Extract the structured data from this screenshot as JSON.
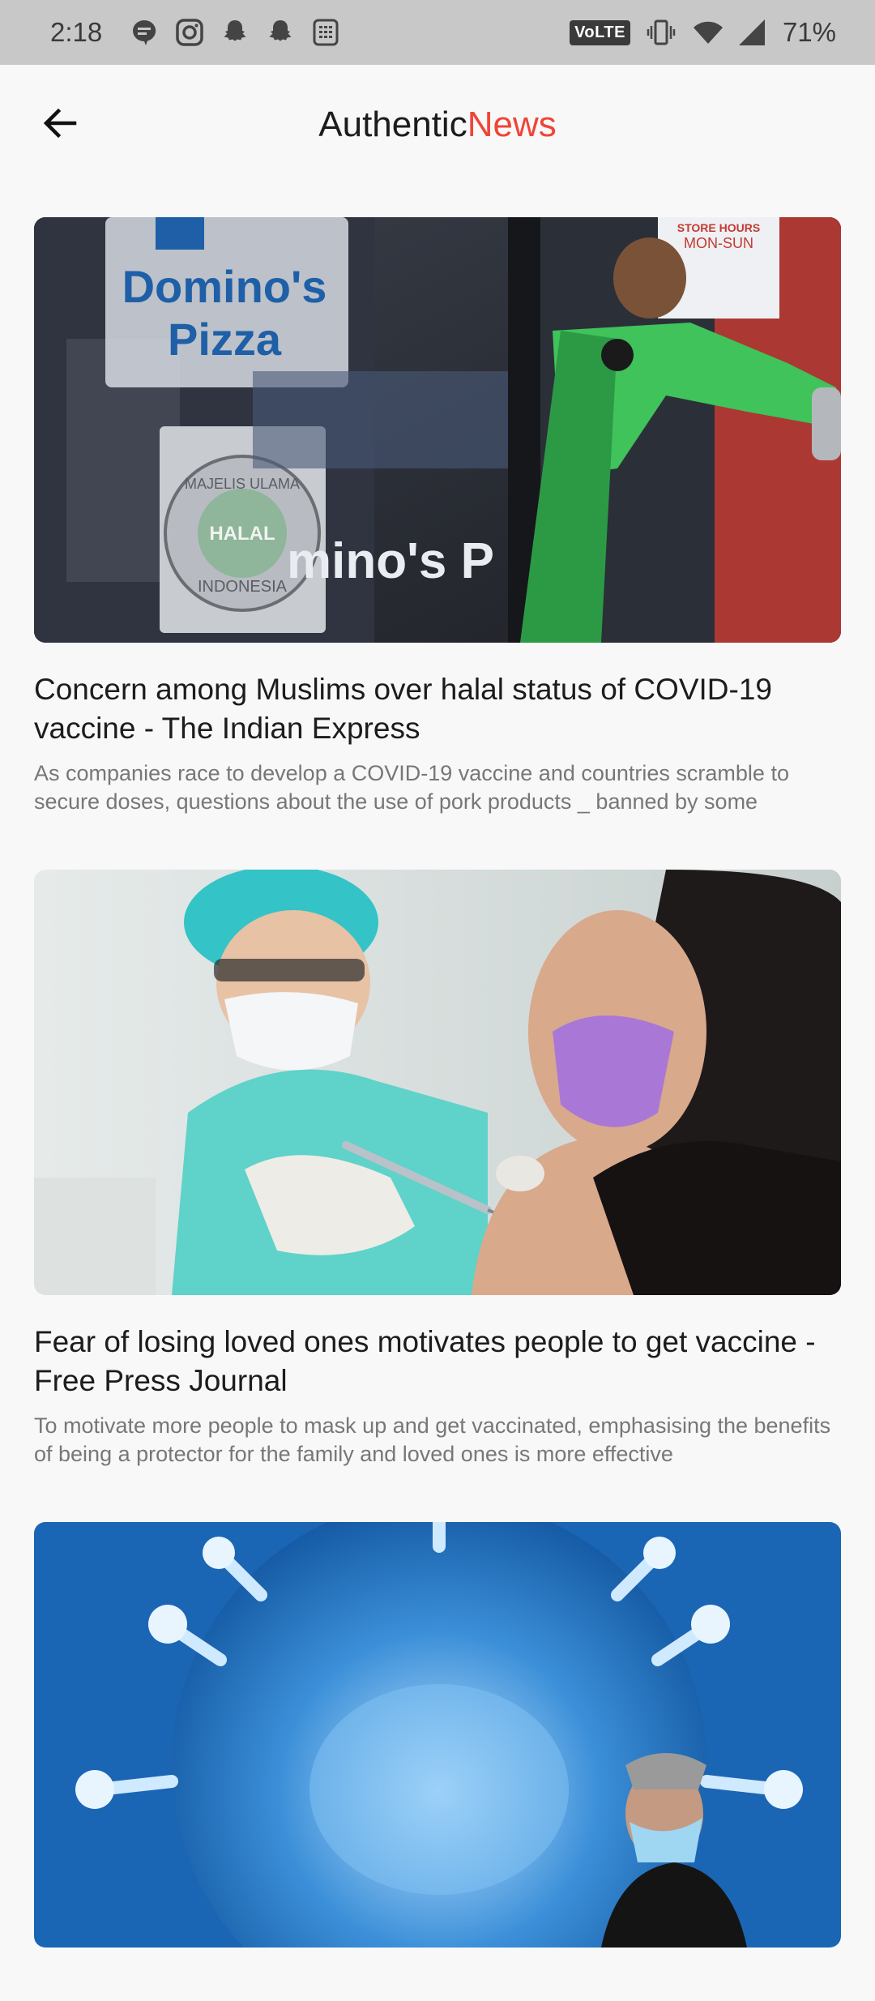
{
  "status_bar": {
    "time": "2:18",
    "network": "VoLTE",
    "battery": "71%"
  },
  "app_bar": {
    "brand_primary": "Authentic",
    "brand_accent": "News",
    "accent_color": "#f04438"
  },
  "articles": [
    {
      "title": "Concern among Muslims over halal status of COVID-19 vaccine - The Indian Express",
      "summary": "As companies race to develop a COVID-19 vaccine and countries scramble to secure doses, questions about the use of pork products _ banned by some",
      "image": {
        "sign_line1": "Domino's",
        "sign_line2": "Pizza",
        "seal_top": "MAJELIS ULAMA",
        "seal_center": "HALAL",
        "seal_bottom": "INDONESIA",
        "glass_text": "mino's P",
        "hours_title": "STORE HOURS",
        "hours_days": "MON-SUN"
      }
    },
    {
      "title": "Fear of losing loved ones motivates people to get vaccine - Free Press Journal",
      "summary": "To motivate more people to mask up and get vaccinated, emphasising the benefits of being a protector for the family and loved ones is more effective"
    },
    {
      "title": "",
      "summary": ""
    }
  ]
}
